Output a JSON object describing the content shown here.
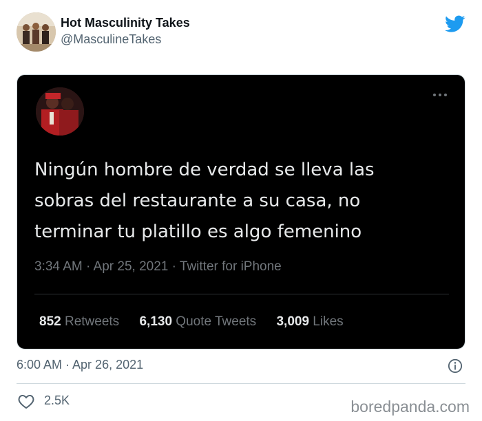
{
  "account": {
    "name": "Hot Masculinity Takes",
    "handle": "@MasculineTakes"
  },
  "screenshot": {
    "text": "Ningún hombre de verdad se lleva las sobras del restaurante a su casa, no terminar tu platillo es algo femenino",
    "line1": "Ningún hombre de verdad se lleva las",
    "line2": "sobras del restaurante a su casa, no",
    "line3": "terminar tu platillo es algo femenino",
    "meta": "3:34 AM · Apr 25, 2021 · Twitter for iPhone",
    "stats": [
      {
        "count": "852",
        "label": "Retweets"
      },
      {
        "count": "6,130",
        "label": "Quote Tweets"
      },
      {
        "count": "3,009",
        "label": "Likes"
      }
    ]
  },
  "tweet": {
    "timestamp": "6:00 AM · Apr 26, 2021",
    "likes": "2.5K"
  },
  "watermark": "boredpanda.com",
  "colors": {
    "twitter_blue": "#1d9bf0",
    "card_bg": "#000000",
    "muted": "#536471"
  },
  "icons": [
    "twitter-bird-icon",
    "more-icon",
    "info-icon",
    "heart-icon"
  ]
}
